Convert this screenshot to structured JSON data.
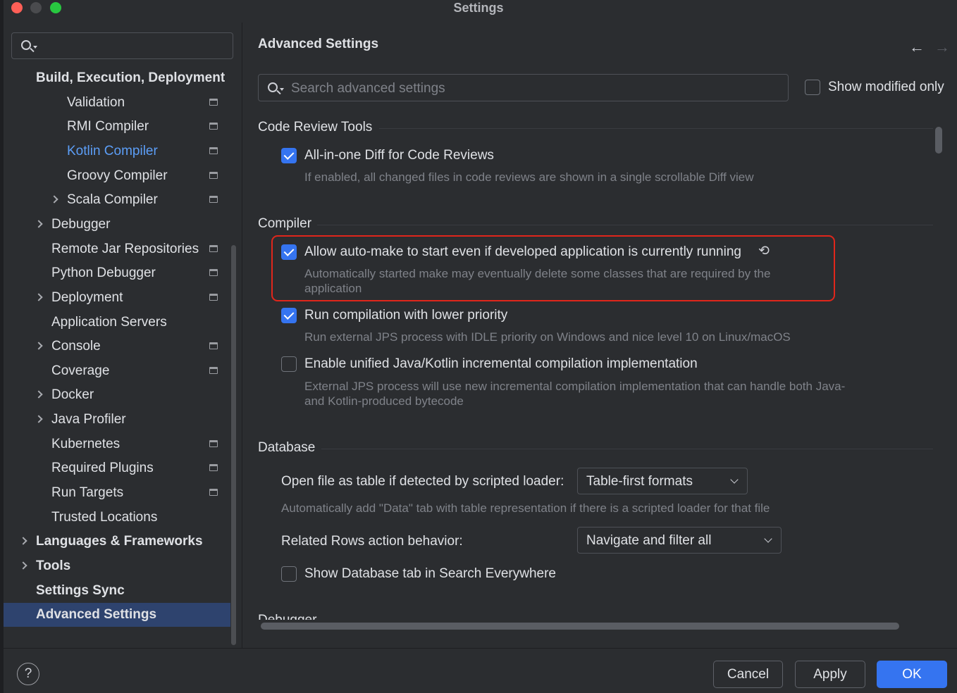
{
  "window": {
    "title": "Settings"
  },
  "sidebar": {
    "search_placeholder": "",
    "items": [
      {
        "label": "Build, Execution, Deployment",
        "level": 0,
        "bold": true,
        "expandable": false,
        "project_icon": false
      },
      {
        "label": "Validation",
        "level": 2,
        "project_icon": true
      },
      {
        "label": "RMI Compiler",
        "level": 2,
        "project_icon": true
      },
      {
        "label": "Kotlin Compiler",
        "level": 2,
        "project_icon": true,
        "active": true
      },
      {
        "label": "Groovy Compiler",
        "level": 2,
        "project_icon": true
      },
      {
        "label": "Scala Compiler",
        "level": 2,
        "project_icon": true,
        "expandable": true
      },
      {
        "label": "Debugger",
        "level": 1,
        "expandable": true
      },
      {
        "label": "Remote Jar Repositories",
        "level": 1,
        "project_icon": true
      },
      {
        "label": "Python Debugger",
        "level": 1,
        "project_icon": true
      },
      {
        "label": "Deployment",
        "level": 1,
        "project_icon": true,
        "expandable": true
      },
      {
        "label": "Application Servers",
        "level": 1
      },
      {
        "label": "Console",
        "level": 1,
        "project_icon": true,
        "expandable": true
      },
      {
        "label": "Coverage",
        "level": 1,
        "project_icon": true
      },
      {
        "label": "Docker",
        "level": 1,
        "expandable": true
      },
      {
        "label": "Java Profiler",
        "level": 1,
        "expandable": true
      },
      {
        "label": "Kubernetes",
        "level": 1,
        "project_icon": true
      },
      {
        "label": "Required Plugins",
        "level": 1,
        "project_icon": true
      },
      {
        "label": "Run Targets",
        "level": 1,
        "project_icon": true
      },
      {
        "label": "Trusted Locations",
        "level": 1
      },
      {
        "label": "Languages & Frameworks",
        "level": 0,
        "bold": true,
        "expandable": true
      },
      {
        "label": "Tools",
        "level": 0,
        "bold": true,
        "expandable": true
      },
      {
        "label": "Settings Sync",
        "level": 0,
        "bold": true
      },
      {
        "label": "Advanced Settings",
        "level": 0,
        "bold": true,
        "selected": true
      }
    ]
  },
  "main": {
    "title": "Advanced Settings",
    "search_placeholder": "Search advanced settings",
    "show_modified_label": "Show modified only",
    "show_modified_checked": false,
    "sections": {
      "code_review": {
        "title": "Code Review Tools",
        "opt1": {
          "label": "All-in-one Diff for Code Reviews",
          "checked": true,
          "desc": "If enabled, all changed files in code reviews are shown in a single scrollable Diff view"
        }
      },
      "compiler": {
        "title": "Compiler",
        "opt1": {
          "label": "Allow auto-make to start even if developed application is currently running",
          "checked": true,
          "desc": "Automatically started make may eventually delete some classes that are required by the application",
          "modified": true
        },
        "opt2": {
          "label": "Run compilation with lower priority",
          "checked": true,
          "desc": "Run external JPS process with IDLE priority on Windows and nice level 10 on Linux/macOS"
        },
        "opt3": {
          "label": "Enable unified Java/Kotlin incremental compilation implementation",
          "checked": false,
          "desc": "External JPS process will use new incremental compilation implementation that can handle both Java- and Kotlin-produced bytecode"
        }
      },
      "database": {
        "title": "Database",
        "open_file_label": "Open file as table if detected by scripted loader:",
        "open_file_value": "Table-first formats",
        "open_file_desc": "Automatically add \"Data\" tab with table representation if there is a scripted loader for that file",
        "related_rows_label": "Related Rows action behavior:",
        "related_rows_value": "Navigate and filter all",
        "show_db_tab_label": "Show Database tab in Search Everywhere",
        "show_db_tab_checked": false
      },
      "next_cutoff_title": "Debugger"
    }
  },
  "footer": {
    "help": "?",
    "cancel": "Cancel",
    "apply": "Apply",
    "ok": "OK"
  },
  "colors": {
    "background": "#2b2d30",
    "accent": "#3574f0",
    "highlight_border": "#e0261b",
    "active_link": "#5c9ef7",
    "selection": "#2e436e"
  }
}
